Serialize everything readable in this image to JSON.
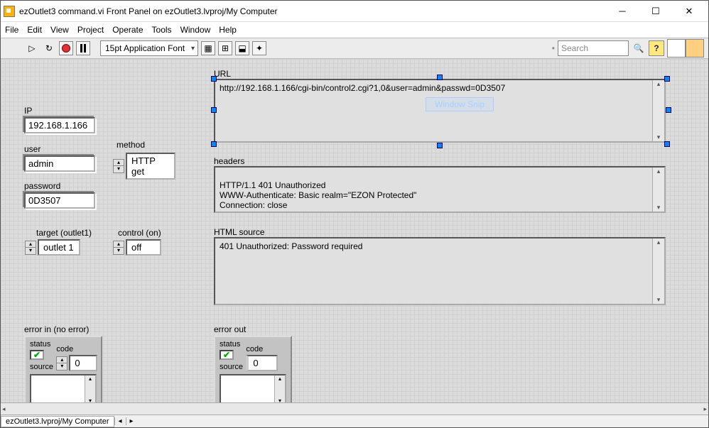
{
  "title": "ezOutlet3 command.vi Front Panel on ezOutlet3.lvproj/My Computer",
  "menu": {
    "file": "File",
    "edit": "Edit",
    "view": "View",
    "project": "Project",
    "operate": "Operate",
    "tools": "Tools",
    "window": "Window",
    "help": "Help"
  },
  "toolbar": {
    "font": "15pt Application Font",
    "search_ph": "Search"
  },
  "labels": {
    "url": "URL",
    "ip": "IP",
    "user": "user",
    "method": "method",
    "password": "password",
    "target": "target (outlet1)",
    "control": "control (on)",
    "headers": "headers",
    "html": "HTML source",
    "error_in": "error in (no error)",
    "error_out": "error out",
    "status": "status",
    "code": "code",
    "source": "source"
  },
  "values": {
    "url": "http://192.168.1.166/cgi-bin/control2.cgi?1,0&user=admin&passwd=0D3507",
    "ip": "192.168.1.166",
    "user": "admin",
    "method": "HTTP get",
    "password": "0D3507",
    "target": "outlet 1",
    "control": "off",
    "headers": "HTTP/1.1 401 Unauthorized\nWWW-Authenticate: Basic realm=\"EZON Protected\"\nConnection: close",
    "html": "401 Unauthorized: Password required",
    "code_in": "0",
    "code_out": "0"
  },
  "watermark": "Window Snip",
  "status_path": "ezOutlet3.lvproj/My Computer"
}
